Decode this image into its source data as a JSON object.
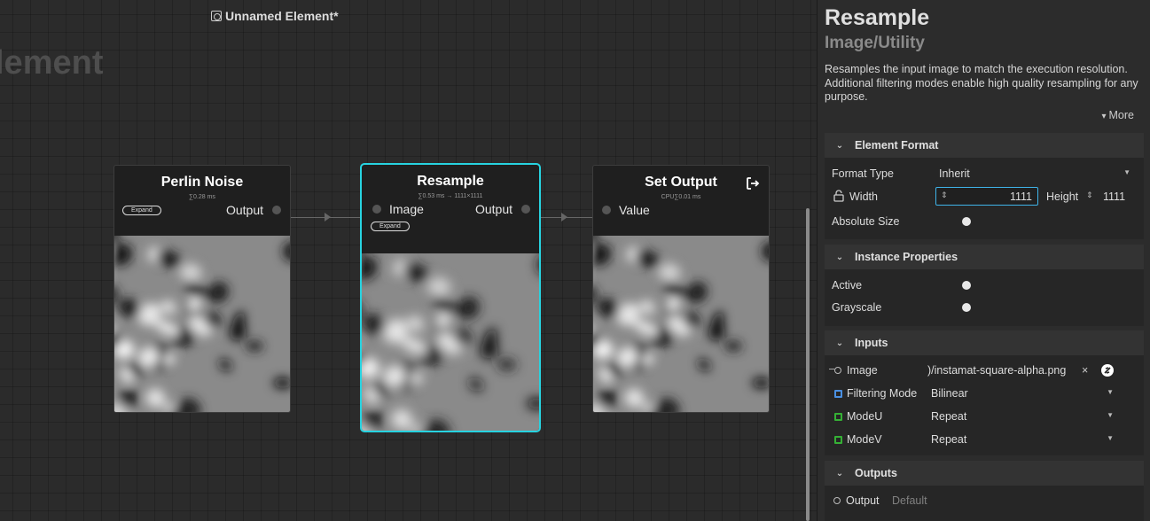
{
  "canvas": {
    "doc_title": "Unnamed Element*",
    "watermark": "lement",
    "nodes": [
      {
        "title": "Perlin Noise",
        "stats": "∑0.28 ms",
        "output_label": "Output",
        "expand_label": "Expand"
      },
      {
        "title": "Resample",
        "stats": "∑0.53 ms → 1111×1111",
        "input_label": "Image",
        "output_label": "Output",
        "expand_label": "Expand"
      },
      {
        "title": "Set Output",
        "stats": "CPU∑0.01 ms",
        "input_label": "Value"
      }
    ]
  },
  "panel": {
    "title": "Resample",
    "category": "Image/Utility",
    "description": "Resamples the input image to match the execution resolution. Additional filtering modes enable high quality resampling for any purpose.",
    "more_label": "More",
    "element_format": {
      "header": "Element Format",
      "format_type_label": "Format Type",
      "format_type_value": "Inherit",
      "width_label": "Width",
      "width_value": "1111",
      "height_label": "Height",
      "height_value": "1111",
      "absolute_size_label": "Absolute Size"
    },
    "instance_properties": {
      "header": "Instance Properties",
      "active_label": "Active",
      "grayscale_label": "Grayscale"
    },
    "inputs": {
      "header": "Inputs",
      "image_label": "Image",
      "image_value": ")/instamat-square-alpha.png",
      "clear_label": "×",
      "filtering_mode_label": "Filtering Mode",
      "filtering_mode_value": "Bilinear",
      "modeu_label": "ModeU",
      "modeu_value": "Repeat",
      "modev_label": "ModeV",
      "modev_value": "Repeat"
    },
    "outputs": {
      "header": "Outputs",
      "output_label": "Output",
      "output_value": "Default"
    }
  },
  "colors": {
    "selection": "#27d3e0",
    "focus": "#3fb3e8",
    "filtering_mode_port": "#4a90e2",
    "mode_port": "#35b035"
  }
}
